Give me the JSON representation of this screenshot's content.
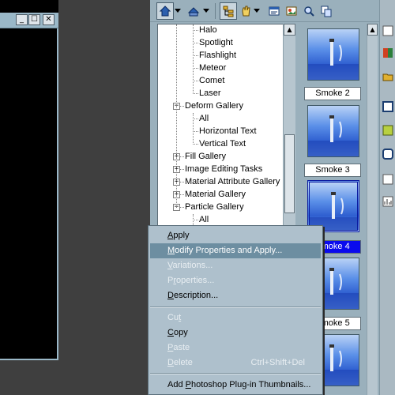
{
  "window": {
    "minimize_glyph": "_",
    "maximize_glyph": "☐",
    "close_glyph": "✕"
  },
  "tree": {
    "items": [
      {
        "label": "Halo",
        "level": 2
      },
      {
        "label": "Spotlight",
        "level": 2
      },
      {
        "label": "Flashlight",
        "level": 2
      },
      {
        "label": "Meteor",
        "level": 2
      },
      {
        "label": "Comet",
        "level": 2
      },
      {
        "label": "Laser",
        "level": 2
      },
      {
        "label": "Deform Gallery",
        "level": 1,
        "expander": "−"
      },
      {
        "label": "All",
        "level": 2
      },
      {
        "label": "Horizontal Text",
        "level": 2
      },
      {
        "label": "Vertical Text",
        "level": 2
      },
      {
        "label": "Fill Gallery",
        "level": 1,
        "expander": "+"
      },
      {
        "label": "Image Editing Tasks",
        "level": 1,
        "expander": "+"
      },
      {
        "label": "Material Attribute Gallery",
        "level": 1,
        "expander": "+"
      },
      {
        "label": "Material Gallery",
        "level": 1,
        "expander": "+"
      },
      {
        "label": "Particle Gallery",
        "level": 1,
        "expander": "−"
      },
      {
        "label": "All",
        "level": 2
      }
    ]
  },
  "thumbnails": [
    {
      "label": "Smoke 2",
      "selected": false
    },
    {
      "label": "Smoke 3",
      "selected": false
    },
    {
      "label": "Smoke 4",
      "selected": true
    },
    {
      "label": "Smoke 5",
      "selected": false
    }
  ],
  "context_menu": {
    "apply": {
      "pre": "",
      "u": "A",
      "post": "pply"
    },
    "modify": {
      "pre": "",
      "u": "M",
      "post": "odify Properties and Apply..."
    },
    "variations": {
      "pre": "",
      "u": "V",
      "post": "ariations..."
    },
    "properties": {
      "pre": "P",
      "u": "r",
      "post": "operties..."
    },
    "description": {
      "pre": "",
      "u": "D",
      "post": "escription..."
    },
    "cut": {
      "pre": "Cu",
      "u": "t",
      "post": ""
    },
    "copy": {
      "pre": "",
      "u": "C",
      "post": "opy"
    },
    "paste": {
      "pre": "",
      "u": "P",
      "post": "aste"
    },
    "delete": {
      "pre": "",
      "u": "D",
      "post": "elete",
      "shortcut": "Ctrl+Shift+Del"
    },
    "add_plugin": {
      "pre": "Add ",
      "u": "P",
      "post": "hotoshop Plug-in Thumbnails..."
    }
  },
  "colors": {
    "menu_hover": "#6d8ea1",
    "selection": "#0a0aee"
  }
}
